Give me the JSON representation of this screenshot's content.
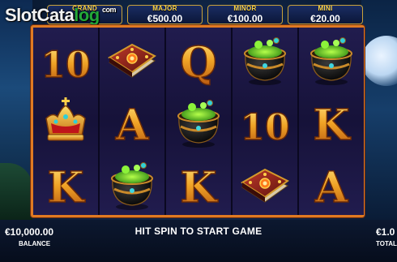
{
  "logo": {
    "main": "SlotCata",
    "tail": "log",
    "suffix": "com"
  },
  "jackpots": [
    {
      "label": "GRAND",
      "value": ""
    },
    {
      "label": "MAJOR",
      "value": "€500.00"
    },
    {
      "label": "MINOR",
      "value": "€100.00"
    },
    {
      "label": "MINI",
      "value": "€20.00"
    }
  ],
  "reels": [
    [
      "10",
      "crown",
      "K"
    ],
    [
      "book",
      "A",
      "cauldron"
    ],
    [
      "Q",
      "cauldron",
      "K"
    ],
    [
      "cauldron",
      "10",
      "book"
    ],
    [
      "cauldron",
      "K",
      "A"
    ]
  ],
  "balance": {
    "value": "€10,000.00",
    "label": "BALANCE"
  },
  "message": "HIT SPIN TO START GAME",
  "total_bet": {
    "value": "€1.0",
    "label": "TOTAL"
  },
  "colors": {
    "frame": "#e07a22",
    "jackpot_label": "#ffd84a",
    "brand_green": "#22a838"
  }
}
